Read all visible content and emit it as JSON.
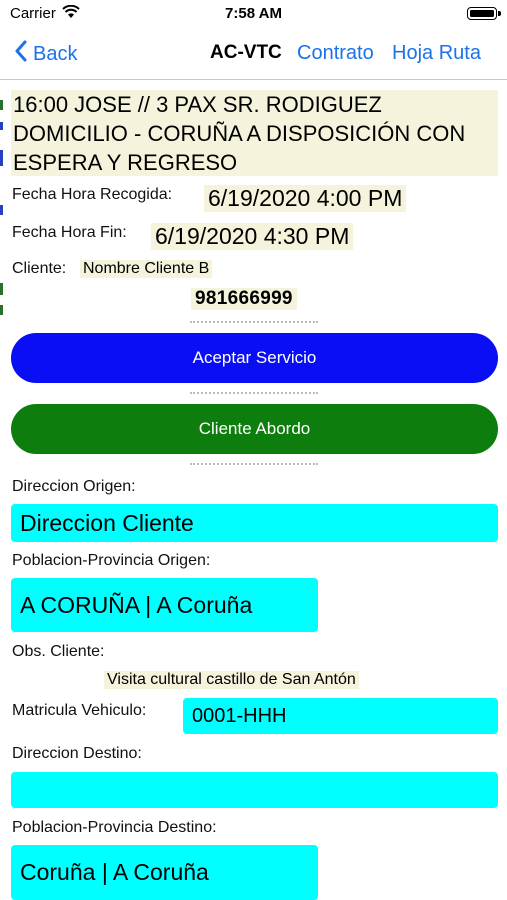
{
  "status_bar": {
    "carrier": "Carrier",
    "time": "7:58 AM"
  },
  "nav": {
    "back": "Back",
    "title": "AC-VTC",
    "contrato": "Contrato",
    "hoja_ruta": "Hoja Ruta"
  },
  "service": {
    "title_line1": "16:00 JOSE // 3 PAX SR. RODIGUEZ",
    "title_line2": "DOMICILIO - CORUÑA A DISPOSICIÓN CON",
    "title_line3": "ESPERA Y REGRESO",
    "fecha_recogida_label": "Fecha Hora Recogida:",
    "fecha_recogida_value": "6/19/2020 4:00 PM",
    "fecha_fin_label": "Fecha Hora Fin:",
    "fecha_fin_value": "6/19/2020 4:30 PM",
    "cliente_label": "Cliente:",
    "cliente_value": "Nombre Cliente B",
    "telefono": "981666999"
  },
  "buttons": {
    "aceptar": "Aceptar Servicio",
    "abordo": "Cliente Abordo"
  },
  "form": {
    "dir_origen_label": "Direccion Origen:",
    "dir_origen_value": "Direccion Cliente",
    "pob_origen_label": "Poblacion-Provincia Origen:",
    "pob_origen_value": "A CORUÑA | A Coruña",
    "obs_label": "Obs. Cliente:",
    "obs_value": "Visita cultural castillo de San Antón",
    "matricula_label": "Matricula Vehiculo:",
    "matricula_value": "0001-HHH",
    "dir_destino_label": "Direccion Destino:",
    "dir_destino_value": "",
    "pob_destino_label": "Poblacion-Provincia Destino:",
    "pob_destino_value": "Coruña | A Coruña"
  },
  "colors": {
    "accent": "#1a73e8",
    "blue_button": "#0a0ef5",
    "green_button": "#0d7d0d",
    "field": "#00ffff",
    "highlight": "#f5f3dc"
  }
}
